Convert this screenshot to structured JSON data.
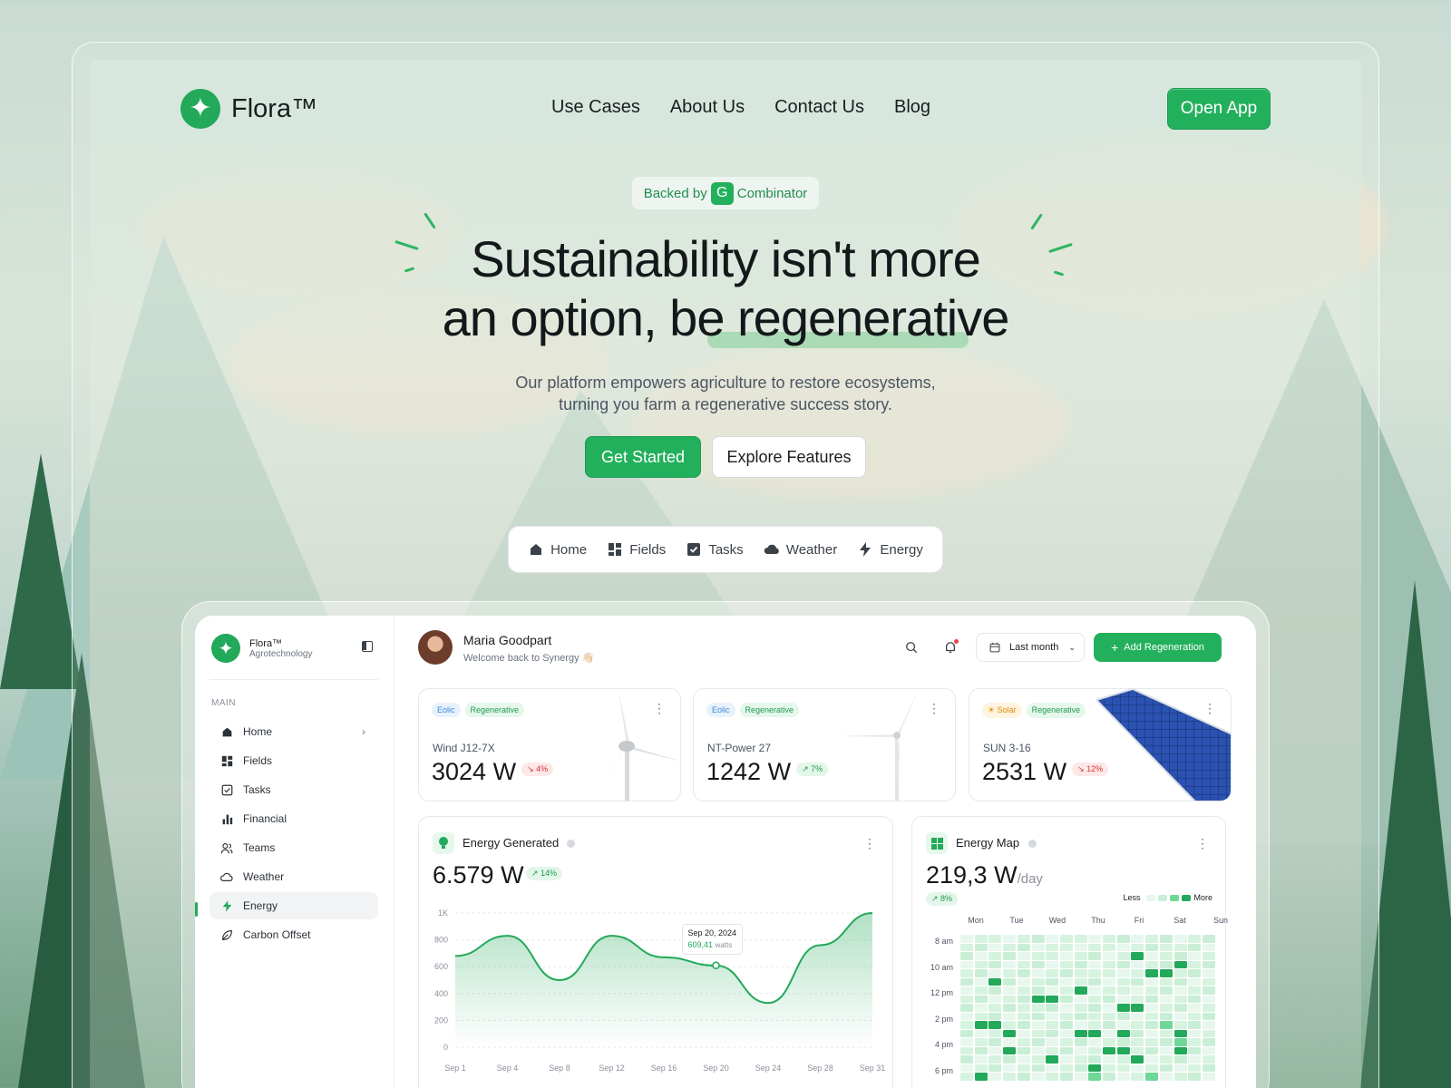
{
  "brand": {
    "name": "Flora™"
  },
  "nav": {
    "items": [
      "Use Cases",
      "About Us",
      "Contact Us",
      "Blog"
    ],
    "cta": "Open App"
  },
  "hero": {
    "badge_prefix": "Backed by",
    "badge_logo": "G",
    "badge_suffix": "Combinator",
    "title_line1": "Sustainability isn't more",
    "title_line2": "an option, be regenerative",
    "subtitle_line1": "Our platform empowers agriculture to restore ecosystems,",
    "subtitle_line2": "turning you farm a regenerative success story.",
    "primary_cta": "Get Started",
    "secondary_cta": "Explore Features"
  },
  "feature_tabs": [
    {
      "label": "Home",
      "icon": "home-icon"
    },
    {
      "label": "Fields",
      "icon": "fields-icon"
    },
    {
      "label": "Tasks",
      "icon": "tasks-icon"
    },
    {
      "label": "Weather",
      "icon": "weather-icon"
    },
    {
      "label": "Energy",
      "icon": "energy-icon"
    }
  ],
  "dashboard": {
    "brand_name": "Flora™",
    "brand_sub": "Agrotechnology",
    "section_label": "MAIN",
    "sidebar": [
      {
        "label": "Home",
        "icon": "home-icon"
      },
      {
        "label": "Fields",
        "icon": "fields-icon"
      },
      {
        "label": "Tasks",
        "icon": "tasks-icon"
      },
      {
        "label": "Financial",
        "icon": "chart-icon"
      },
      {
        "label": "Teams",
        "icon": "teams-icon"
      },
      {
        "label": "Weather",
        "icon": "weather-icon"
      },
      {
        "label": "Energy",
        "icon": "energy-icon"
      },
      {
        "label": "Carbon Offset",
        "icon": "leaf-icon"
      }
    ],
    "active_item": "Energy",
    "user": {
      "name": "Maria Goodpart",
      "welcome": "Welcome back to Synergy 👋🏻"
    },
    "period": "Last month",
    "add_button": "Add Regeneration",
    "cards": [
      {
        "tags": [
          "Eolic",
          "Regenerative"
        ],
        "name": "Wind J12-7X",
        "value": "3024 W",
        "change": "4%",
        "direction": "down"
      },
      {
        "tags": [
          "Eolic",
          "Regenerative"
        ],
        "name": "NT-Power 27",
        "value": "1242 W",
        "change": "7%",
        "direction": "up"
      },
      {
        "tags": [
          "Solar",
          "Regenerative"
        ],
        "name": "SUN 3-16",
        "value": "2531 W",
        "change": "12%",
        "direction": "down"
      }
    ],
    "energy_generated": {
      "title": "Energy Generated",
      "value": "6.579 W",
      "change": "14%",
      "tooltip_date": "Sep 20, 2024",
      "tooltip_value": "609,41",
      "tooltip_unit": "watts"
    },
    "energy_map": {
      "title": "Energy Map",
      "value": "219,3 W",
      "unit": "/day",
      "change": "8%",
      "legend_less": "Less",
      "legend_more": "More",
      "days": [
        "Mon",
        "Tue",
        "Wed",
        "Thu",
        "Fri",
        "Sat",
        "Sun"
      ],
      "times": [
        "8 am",
        "10 am",
        "12 pm",
        "2 pm",
        "4 pm",
        "6 pm"
      ]
    }
  },
  "chart_data": {
    "type": "area",
    "title": "Energy Generated",
    "xlabel": "",
    "ylabel": "",
    "x": [
      "Sep 1",
      "Sep 4",
      "Sep 8",
      "Sep 12",
      "Sep 16",
      "Sep 20",
      "Sep 24",
      "Sep 28",
      "Sep 31"
    ],
    "y": [
      680,
      830,
      500,
      830,
      670,
      609,
      330,
      760,
      1000
    ],
    "yticks": [
      "0",
      "200",
      "400",
      "600",
      "800",
      "1K"
    ],
    "ylim": [
      0,
      1000
    ],
    "grid": true,
    "color": "#22a95a",
    "highlight": {
      "x": "Sep 20",
      "y": 609.41
    }
  },
  "colors": {
    "accent": "#23b05c",
    "accent_dark": "#1e9a50",
    "down": "#d33333"
  }
}
